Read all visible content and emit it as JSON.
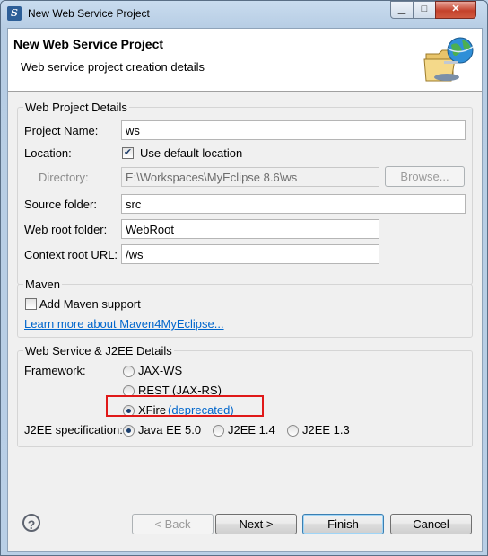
{
  "window": {
    "title": "New Web Service Project",
    "min_glyph": "▁",
    "max_glyph": "□",
    "close_glyph": "✕"
  },
  "banner": {
    "title": "New Web Service Project",
    "subtitle": "Web service project creation details"
  },
  "web_project": {
    "label": "Web Project Details",
    "project_name_label": "Project Name:",
    "project_name_value": "ws",
    "location_label": "Location:",
    "use_default_label": "Use default location",
    "use_default_checked": true,
    "directory_label": "Directory:",
    "directory_value": "E:\\Workspaces\\MyEclipse 8.6\\ws",
    "browse_label": "Browse...",
    "source_folder_label": "Source folder:",
    "source_folder_value": "src",
    "web_root_label": "Web root folder:",
    "web_root_value": "WebRoot",
    "context_root_label": "Context root URL:",
    "context_root_value": "/ws"
  },
  "maven": {
    "label": "Maven",
    "add_support_label": "Add Maven support",
    "add_support_checked": false,
    "learn_more_link": "Learn more about Maven4MyEclipse..."
  },
  "ws_j2ee": {
    "label": "Web Service & J2EE Details",
    "framework_label": "Framework:",
    "frameworks": [
      {
        "label": "JAX-WS",
        "selected": false
      },
      {
        "label": "REST (JAX-RS)",
        "selected": false
      },
      {
        "label": "XFire",
        "selected": true,
        "note_link": "(deprecated)"
      }
    ],
    "j2ee_label": "J2EE specification:",
    "j2ee_options": [
      {
        "label": "Java EE 5.0",
        "selected": true
      },
      {
        "label": "J2EE 1.4",
        "selected": false
      },
      {
        "label": "J2EE 1.3",
        "selected": false
      }
    ]
  },
  "buttons": {
    "help_glyph": "?",
    "back": "< Back",
    "next": "Next >",
    "finish": "Finish",
    "cancel": "Cancel"
  },
  "colors": {
    "highlight_box": "#e01919",
    "link": "#0066cc"
  },
  "icons": {
    "app": "myeclipse-icon",
    "banner": "web-service-globe-folder-icon"
  }
}
